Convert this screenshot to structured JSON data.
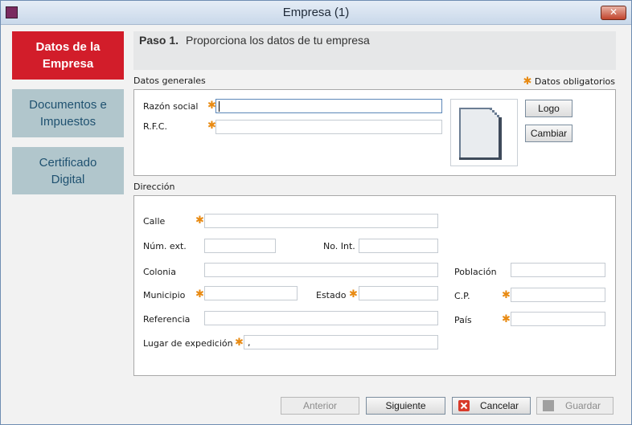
{
  "window": {
    "title": "Empresa (1)",
    "close_glyph": "✕"
  },
  "sidebar": {
    "items": [
      {
        "label": "Datos de la Empresa"
      },
      {
        "label": "Documentos e Impuestos"
      },
      {
        "label": "Certificado Digital"
      }
    ]
  },
  "header": {
    "step_label": "Paso 1.",
    "step_text": "Proporciona los datos de tu empresa"
  },
  "general": {
    "section_label": "Datos generales",
    "required_note": "Datos obligatorios",
    "razon_social": {
      "label": "Razón social",
      "value": ""
    },
    "rfc": {
      "label": "R.F.C.",
      "value": ""
    },
    "logo_icon": "document-icon",
    "logo_button": "Logo",
    "change_button": "Cambiar"
  },
  "address": {
    "section_label": "Dirección",
    "calle": {
      "label": "Calle",
      "value": ""
    },
    "num_ext": {
      "label": "Núm. ext.",
      "value": ""
    },
    "num_int": {
      "label": "No. Int.",
      "value": ""
    },
    "colonia": {
      "label": "Colonia",
      "value": ""
    },
    "poblacion": {
      "label": "Población",
      "value": ""
    },
    "municipio": {
      "label": "Municipio",
      "value": ""
    },
    "estado": {
      "label": "Estado",
      "value": ""
    },
    "cp": {
      "label": "C.P.",
      "value": ""
    },
    "referencia": {
      "label": "Referencia",
      "value": ""
    },
    "pais": {
      "label": "País",
      "value": ""
    },
    "lugar_expedicion": {
      "label": "Lugar de expedición",
      "value": ","
    }
  },
  "footer": {
    "previous": "Anterior",
    "next": "Siguiente",
    "cancel": "Cancelar",
    "save": "Guardar"
  },
  "colors": {
    "accent_red": "#d21d2a",
    "nav_inactive": "#b1c6cc",
    "required_star": "#e88a12"
  }
}
